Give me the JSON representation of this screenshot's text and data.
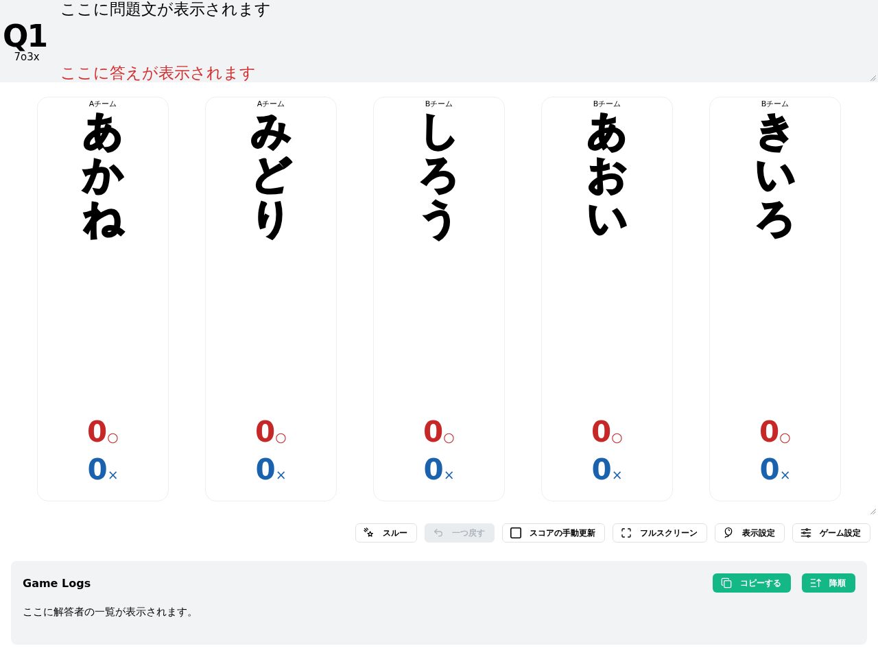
{
  "question": {
    "number": "Q1",
    "tally": "7o3x",
    "text": "ここに問題文が表示されます",
    "answer": "ここに答えが表示されます"
  },
  "players": [
    {
      "team": "Aチーム",
      "name": "あかね",
      "correct": "0",
      "correct_mark": "○",
      "wrong": "0",
      "wrong_mark": "×"
    },
    {
      "team": "Aチーム",
      "name": "みどり",
      "correct": "0",
      "correct_mark": "○",
      "wrong": "0",
      "wrong_mark": "×"
    },
    {
      "team": "Bチーム",
      "name": "しろう",
      "correct": "0",
      "correct_mark": "○",
      "wrong": "0",
      "wrong_mark": "×"
    },
    {
      "team": "Bチーム",
      "name": "あおい",
      "correct": "0",
      "correct_mark": "○",
      "wrong": "0",
      "wrong_mark": "×"
    },
    {
      "team": "Bチーム",
      "name": "きいろ",
      "correct": "0",
      "correct_mark": "○",
      "wrong": "0",
      "wrong_mark": "×"
    }
  ],
  "toolbar": [
    {
      "kind": "button",
      "label": "スルー",
      "disabled": false
    },
    {
      "kind": "button",
      "label": "一つ戻す",
      "disabled": true
    },
    {
      "kind": "toggle",
      "label": "スコアの手動更新",
      "checked": false,
      "disabled": false
    },
    {
      "kind": "button",
      "label": "フルスクリーン",
      "disabled": false
    },
    {
      "kind": "button",
      "label": "表示設定",
      "disabled": false
    },
    {
      "kind": "button",
      "label": "ゲーム設定",
      "disabled": false
    }
  ],
  "game_logs": {
    "title": "Game Logs",
    "buttons": [
      {
        "label": "コピーする"
      },
      {
        "label": "降順"
      }
    ],
    "empty_text": "ここに解答者の一覧が表示されます。"
  }
}
